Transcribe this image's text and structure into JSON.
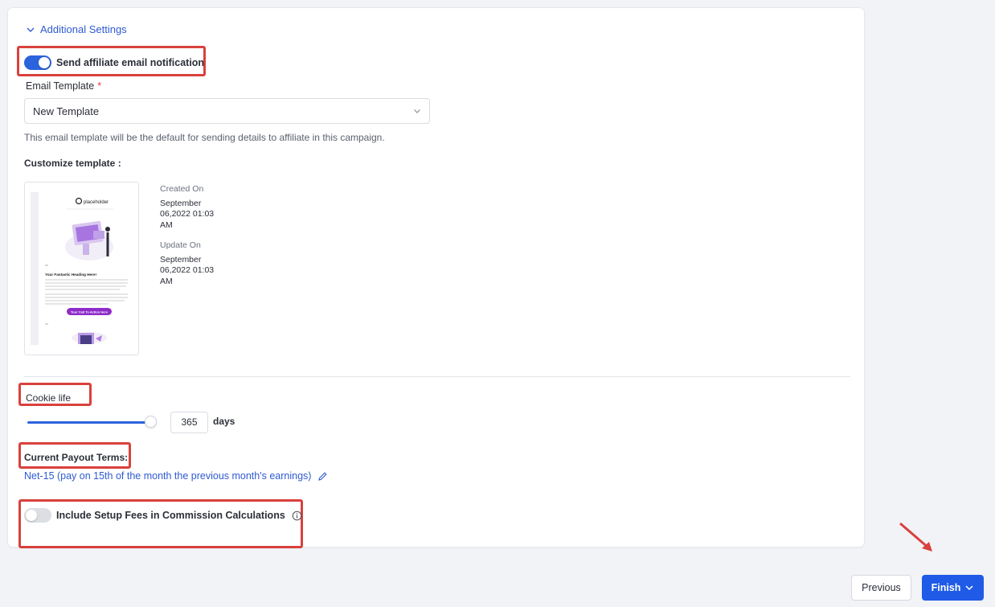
{
  "section": {
    "title": "Additional Settings"
  },
  "affiliate_email": {
    "label": "Send affiliate email notification",
    "enabled": true
  },
  "email_template": {
    "label": "Email Template",
    "required_mark": "*",
    "selected": "New Template",
    "help_text": "This email template will be the default for sending details to affiliate in this campaign."
  },
  "customize": {
    "title": "Customize template :",
    "created_label": "Created On",
    "created_line1": "September",
    "created_line2": "06,2022 01:03",
    "created_line3": "AM",
    "updated_label": "Update On",
    "updated_line1": "September",
    "updated_line2": "06,2022 01:03",
    "updated_line3": "AM",
    "preview": {
      "logo_text": "placeholder",
      "heading": "Your Fantastic Heading Here!",
      "cta": "Your Call To Action Here"
    }
  },
  "cookie": {
    "label": "Cookie life",
    "value": "365",
    "unit": "days",
    "slider_fraction": 1.0
  },
  "payout": {
    "title": "Current Payout Terms:",
    "terms": "Net-15 (pay on 15th of the month the previous month's earnings)"
  },
  "setup_fees": {
    "label": "Include Setup Fees in Commission Calculations",
    "enabled": false
  },
  "footer": {
    "previous_label": "Previous",
    "finish_label": "Finish"
  },
  "colors": {
    "accent": "#2a63dc",
    "highlight": "#d9413d",
    "finish_button": "#1f5be6"
  },
  "icons": [
    "chevron-down-icon",
    "chevron-down-icon",
    "pencil-icon",
    "info-icon",
    "chevron-down-icon",
    "arrow-icon"
  ]
}
